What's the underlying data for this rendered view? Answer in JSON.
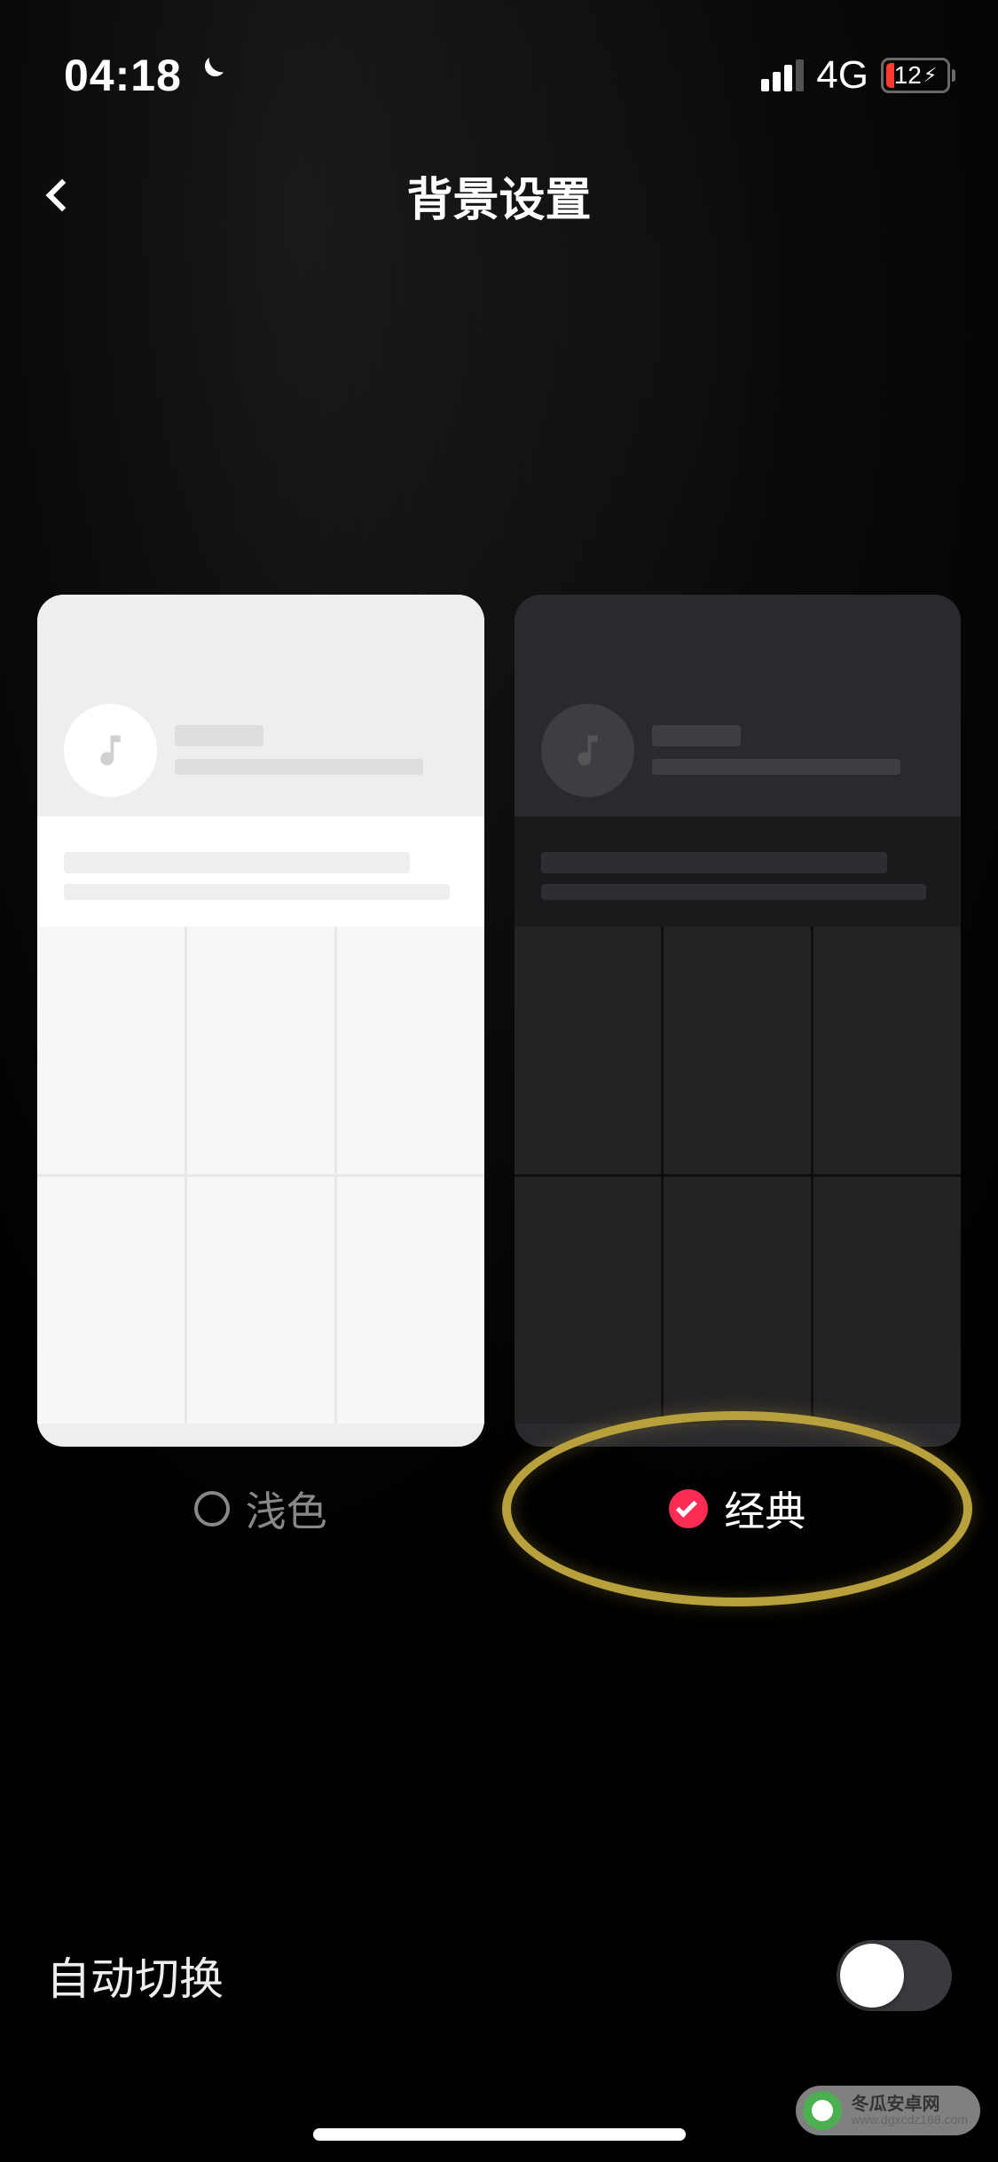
{
  "statusBar": {
    "time": "04:18",
    "networkType": "4G",
    "batteryPercent": "12",
    "batteryCharging": true
  },
  "header": {
    "title": "背景设置"
  },
  "themes": {
    "light": {
      "label": "浅色",
      "selected": false
    },
    "classic": {
      "label": "经典",
      "selected": true
    }
  },
  "autoSwitch": {
    "label": "自动切换",
    "enabled": false
  },
  "watermark": {
    "title": "冬瓜安卓网",
    "url": "www.dgxcdz168.com"
  },
  "colors": {
    "accent": "#fe2c55",
    "highlight": "#b8a03d",
    "batteryLow": "#ff3b30"
  }
}
